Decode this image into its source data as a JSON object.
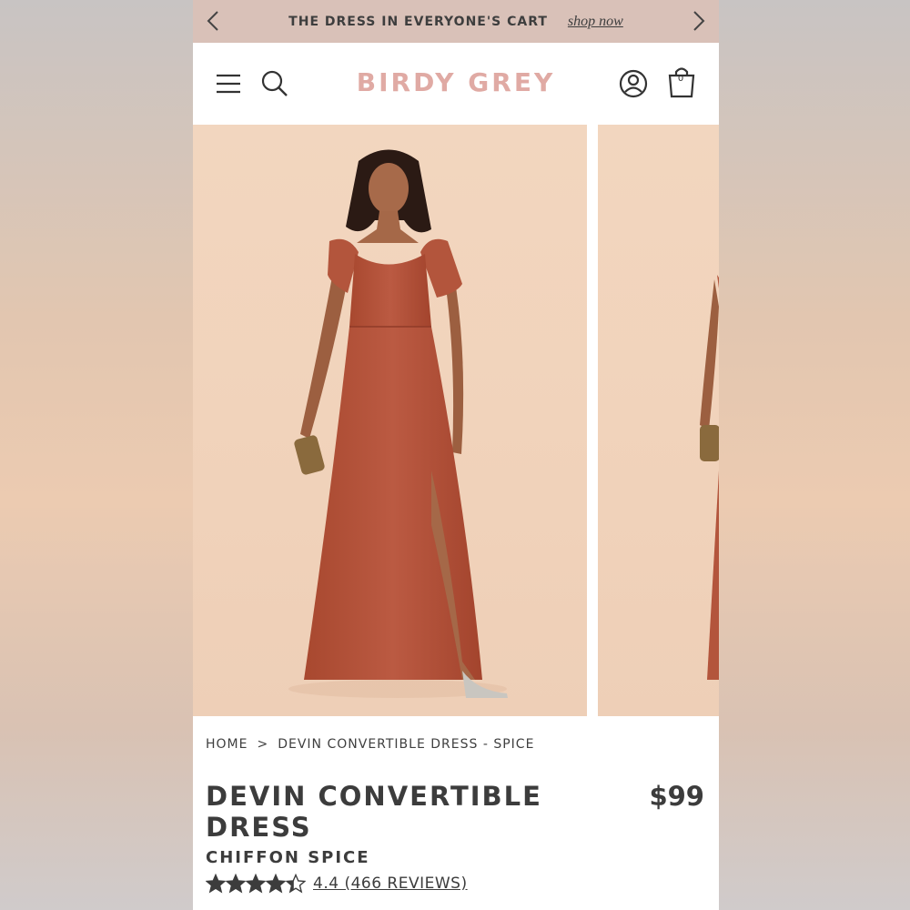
{
  "promo": {
    "text": "THE DRESS IN EVERYONE'S CART",
    "link": "shop now"
  },
  "header": {
    "logo": "BIRDY GREY",
    "cart_count": "0"
  },
  "breadcrumb": {
    "home": "HOME",
    "separator": ">",
    "current": "DEVIN CONVERTIBLE DRESS - SPICE"
  },
  "product": {
    "title": "DEVIN CONVERTIBLE DRESS",
    "price": "$99",
    "variant": "CHIFFON SPICE",
    "rating_value": 4.4,
    "rating_text": "4.4 (466 REVIEWS)"
  },
  "colors": {
    "logo": "#e0aaa4",
    "promo_bg": "#d9c1b8",
    "dress": "#b5533e",
    "photo_bg": "#f1d3bb"
  }
}
